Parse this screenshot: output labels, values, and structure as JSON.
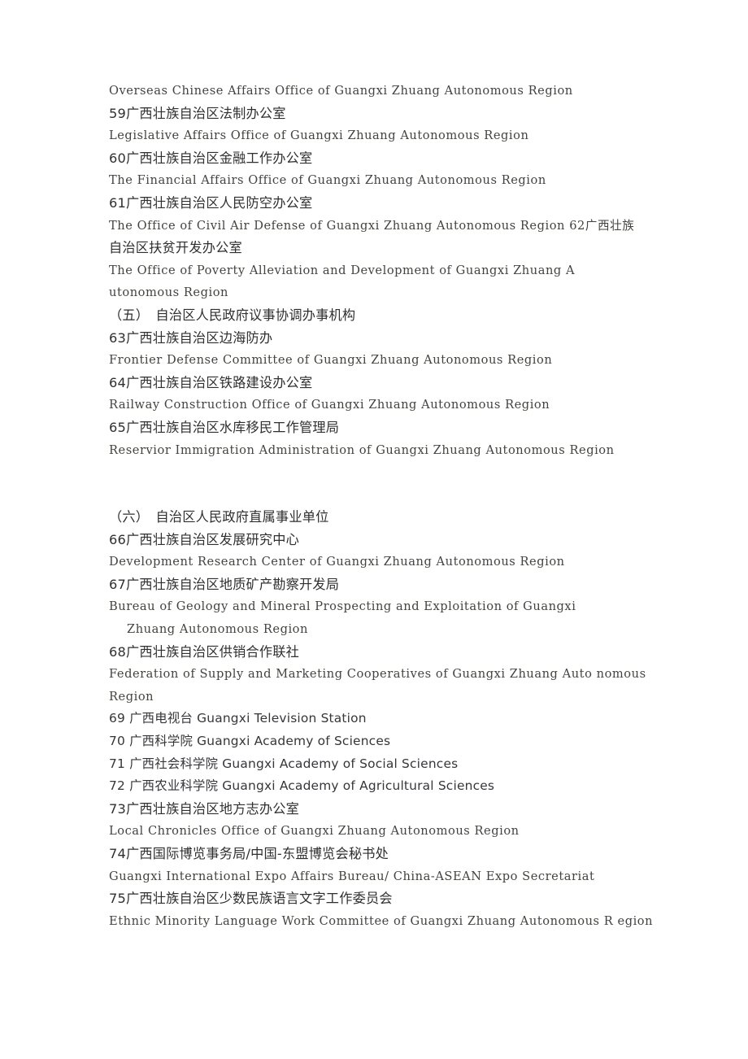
{
  "document": {
    "page_background": "#ffffff",
    "text_color": "#3a3a3a",
    "blocks": [
      {
        "id": "block-1",
        "lines": [
          {
            "id": "l1",
            "kind": "latin",
            "text": "Overseas Chinese Affairs Office of Guangxi Zhuang Autonomous Region"
          },
          {
            "id": "l2",
            "kind": "cjk",
            "text": "59广西壮族自治区法制办公室"
          },
          {
            "id": "l3",
            "kind": "latin",
            "text": "Legislative Affairs Office of Guangxi Zhuang Autonomous Region"
          },
          {
            "id": "l4",
            "kind": "cjk",
            "text": "60广西壮族自治区金融工作办公室"
          },
          {
            "id": "l5",
            "kind": "latin",
            "text": "The Financial Affairs Office of Guangxi Zhuang Autonomous Region"
          },
          {
            "id": "l6",
            "kind": "cjk",
            "text": "61广西壮族自治区人民防空办公室"
          },
          {
            "id": "l7",
            "kind": "latin",
            "text": "The Office of Civil Air Defense of Guangxi Zhuang Autonomous Region 62广西壮族"
          },
          {
            "id": "l8",
            "kind": "cjk",
            "text": "自治区扶贫开发办公室"
          },
          {
            "id": "l9",
            "kind": "latin",
            "text": "The Office of Poverty Alleviation and Development of Guangxi Zhuang A"
          },
          {
            "id": "l10",
            "kind": "latin",
            "text": "utonomous Region"
          },
          {
            "id": "l11",
            "kind": "heading",
            "text": "（五）　自治区人民政府议事协调办事机构"
          },
          {
            "id": "l12",
            "kind": "cjk",
            "text": "63广西壮族自治区边海防办"
          },
          {
            "id": "l13",
            "kind": "latin",
            "text": "Frontier Defense Committee of Guangxi Zhuang Autonomous Region"
          },
          {
            "id": "l14",
            "kind": "cjk",
            "text": "64广西壮族自治区铁路建设办公室"
          },
          {
            "id": "l15",
            "kind": "latin",
            "text": "Railway Construction Office of Guangxi Zhuang Autonomous Region"
          },
          {
            "id": "l16",
            "kind": "cjk",
            "text": "65广西壮族自治区水库移民工作管理局"
          },
          {
            "id": "l17",
            "kind": "latin",
            "text": "Reservior Immigration Administration of Guangxi Zhuang Autonomous Region"
          }
        ]
      },
      {
        "id": "block-2",
        "lines": [
          {
            "id": "l18",
            "kind": "heading",
            "text": "（六）　自治区人民政府直属事业单位"
          },
          {
            "id": "l19",
            "kind": "cjk",
            "text": "66广西壮族自治区发展研究中心"
          },
          {
            "id": "l20",
            "kind": "latin",
            "text": "Development Research Center of Guangxi Zhuang Autonomous Region"
          },
          {
            "id": "l21",
            "kind": "cjk",
            "text": "67广西壮族自治区地质矿产勘察开发局"
          },
          {
            "id": "l22",
            "kind": "latin",
            "text": "Bureau of Geology and Mineral Prospecting and Exploitation of Guangxi"
          },
          {
            "id": "l23",
            "kind": "latin-indent",
            "text": "Zhuang Autonomous Region"
          },
          {
            "id": "l24",
            "kind": "cjk",
            "text": "68广西壮族自治区供销合作联社"
          },
          {
            "id": "l25",
            "kind": "latin",
            "text": "Federation of Supply and Marketing Cooperatives of Guangxi Zhuang Auto nomous"
          },
          {
            "id": "l26",
            "kind": "latin",
            "text": "Region"
          },
          {
            "id": "l27",
            "kind": "mixed",
            "text": "69 广西电视台 Guangxi Television Station"
          },
          {
            "id": "l28",
            "kind": "mixed",
            "text": "70 广西科学院 Guangxi Academy of Sciences"
          },
          {
            "id": "l29",
            "kind": "mixed",
            "text": "71 广西社会科学院 Guangxi Academy of Social Sciences"
          },
          {
            "id": "l30",
            "kind": "mixed",
            "text": "72 广西农业科学院 Guangxi Academy of Agricultural Sciences"
          },
          {
            "id": "l31",
            "kind": "cjk",
            "text": "73广西壮族自治区地方志办公室"
          },
          {
            "id": "l32",
            "kind": "latin",
            "text": "Local Chronicles Office of Guangxi Zhuang Autonomous Region"
          },
          {
            "id": "l33",
            "kind": "cjk",
            "text": "74广西国际博览事务局/中国-东盟博览会秘书处"
          },
          {
            "id": "l34",
            "kind": "latin",
            "text": "Guangxi International Expo Affairs Bureau/ China-ASEAN Expo Secretariat"
          },
          {
            "id": "l35",
            "kind": "cjk",
            "text": "75广西壮族自治区少数民族语言文字工作委员会"
          },
          {
            "id": "l36",
            "kind": "latin",
            "text": "Ethnic Minority Language Work Committee of Guangxi Zhuang Autonomous R egion"
          }
        ]
      }
    ]
  }
}
